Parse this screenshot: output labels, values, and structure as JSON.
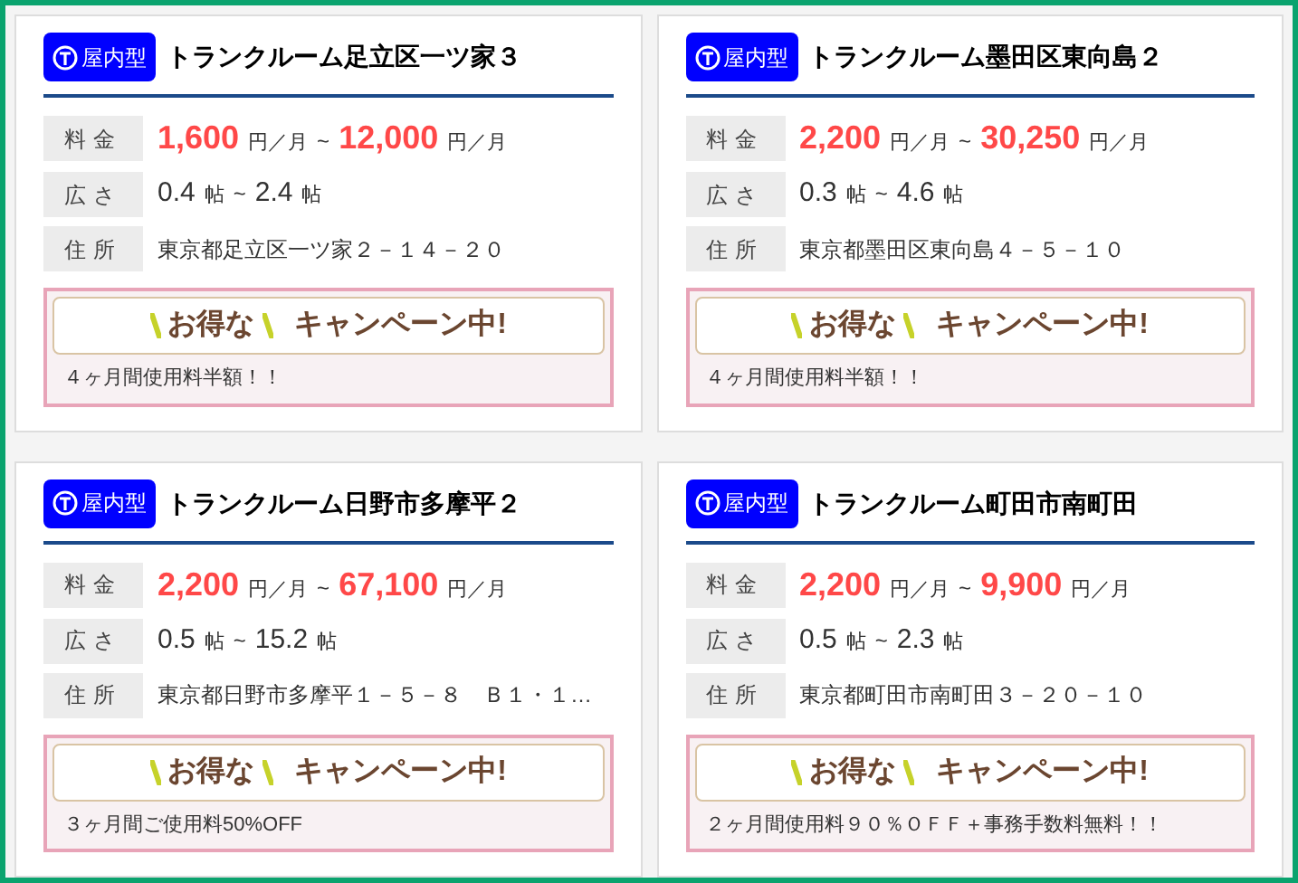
{
  "cards": [
    {
      "badge": "屋内型",
      "title": "トランクルーム足立区一ツ家３",
      "price": {
        "label": "料金",
        "min": "1,600",
        "unit": "円／月",
        "sep": "~",
        "max": "12,000",
        "unit_max": "円／月"
      },
      "area": {
        "label": "広さ",
        "min": "0.4",
        "unit": "帖",
        "sep": "~",
        "max": "2.4",
        "unit_max": "帖"
      },
      "address": {
        "label": "住所",
        "value": "東京都足立区一ツ家２－１４－２０"
      },
      "campaign": {
        "banner_left": "お得な",
        "banner_right": "キャンペーン中!",
        "note": "４ヶ月間使用料半額！！"
      }
    },
    {
      "badge": "屋内型",
      "title": "トランクルーム墨田区東向島２",
      "price": {
        "label": "料金",
        "min": "2,200",
        "unit": "円／月",
        "sep": "~",
        "max": "30,250",
        "unit_max": "円／月"
      },
      "area": {
        "label": "広さ",
        "min": "0.3",
        "unit": "帖",
        "sep": "~",
        "max": "4.6",
        "unit_max": "帖"
      },
      "address": {
        "label": "住所",
        "value": "東京都墨田区東向島４－５－１０"
      },
      "campaign": {
        "banner_left": "お得な",
        "banner_right": "キャンペーン中!",
        "note": "４ヶ月間使用料半額！！"
      }
    },
    {
      "badge": "屋内型",
      "title": "トランクルーム日野市多摩平２",
      "price": {
        "label": "料金",
        "min": "2,200",
        "unit": "円／月",
        "sep": "~",
        "max": "67,100",
        "unit_max": "円／月"
      },
      "area": {
        "label": "広さ",
        "min": "0.5",
        "unit": "帖",
        "sep": "~",
        "max": "15.2",
        "unit_max": "帖"
      },
      "address": {
        "label": "住所",
        "value": "東京都日野市多摩平１－５－８　Ｂ１・１…"
      },
      "campaign": {
        "banner_left": "お得な",
        "banner_right": "キャンペーン中!",
        "note": "３ヶ月間ご使用料50%OFF"
      }
    },
    {
      "badge": "屋内型",
      "title": "トランクルーム町田市南町田",
      "price": {
        "label": "料金",
        "min": "2,200",
        "unit": "円／月",
        "sep": "~",
        "max": "9,900",
        "unit_max": "円／月"
      },
      "area": {
        "label": "広さ",
        "min": "0.5",
        "unit": "帖",
        "sep": "~",
        "max": "2.3",
        "unit_max": "帖"
      },
      "address": {
        "label": "住所",
        "value": "東京都町田市南町田３－２０－１０"
      },
      "campaign": {
        "banner_left": "お得な",
        "banner_right": "キャンペーン中!",
        "note": "２ヶ月間使用料９０％ＯＦＦ＋事務手数料無料！！"
      }
    }
  ]
}
